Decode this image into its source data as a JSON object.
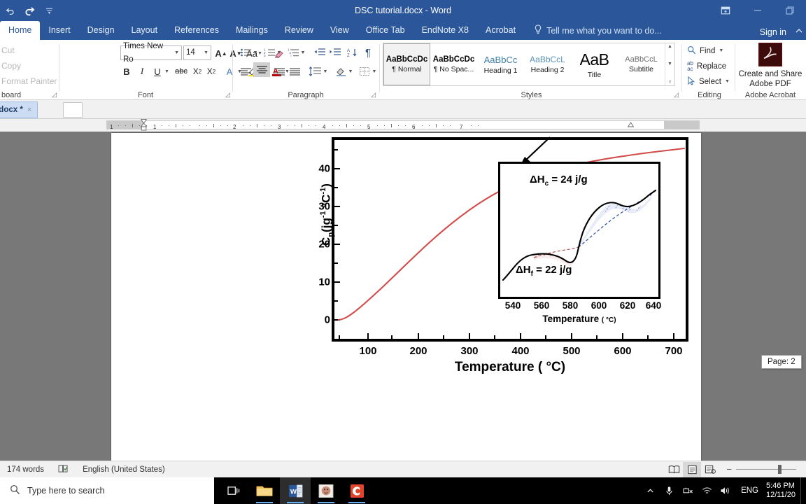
{
  "titlebar": {
    "document_title": "DSC tutorial.docx - Word",
    "quick_access": [
      {
        "name": "undo",
        "glyph": "↶"
      },
      {
        "name": "redo",
        "glyph": "↷"
      },
      {
        "name": "customize-quick-access-toolbar",
        "glyph": "≡"
      }
    ],
    "window_buttons": [
      {
        "name": "ribbon-display-options",
        "glyph": "▣"
      },
      {
        "name": "minimize",
        "glyph": "–"
      },
      {
        "name": "restore",
        "glyph": "❐"
      }
    ]
  },
  "ribbon_tabs": {
    "items": [
      {
        "label": "Home",
        "active": true
      },
      {
        "label": "Insert",
        "active": false
      },
      {
        "label": "Design",
        "active": false
      },
      {
        "label": "Layout",
        "active": false
      },
      {
        "label": "References",
        "active": false
      },
      {
        "label": "Mailings",
        "active": false
      },
      {
        "label": "Review",
        "active": false
      },
      {
        "label": "View",
        "active": false
      },
      {
        "label": "Office Tab",
        "active": false
      },
      {
        "label": "EndNote X8",
        "active": false
      },
      {
        "label": "Acrobat",
        "active": false
      }
    ],
    "tell_me": "Tell me what you want to do...",
    "sign_in": "Sign in"
  },
  "ribbon": {
    "clipboard": {
      "group_label": "board",
      "items": [
        "Cut",
        "Copy",
        "Format Painter"
      ]
    },
    "font": {
      "group_label": "Font",
      "font_name": "Times New Ro",
      "font_size": "14",
      "buttons": [
        {
          "name": "grow-font",
          "label": "A↑"
        },
        {
          "name": "shrink-font",
          "label": "A↓"
        },
        {
          "name": "change-case",
          "label": "Aa"
        },
        {
          "name": "clear-formatting",
          "label": "✒"
        },
        {
          "name": "bold",
          "label": "B"
        },
        {
          "name": "italic",
          "label": "I"
        },
        {
          "name": "underline",
          "label": "U"
        },
        {
          "name": "strikethrough",
          "label": "abc"
        },
        {
          "name": "subscript",
          "label": "X₂"
        },
        {
          "name": "superscript",
          "label": "X²"
        },
        {
          "name": "text-effects",
          "label": "A"
        },
        {
          "name": "text-highlight-color",
          "label": "ab"
        },
        {
          "name": "font-color",
          "label": "A"
        }
      ]
    },
    "paragraph": {
      "group_label": "Paragraph",
      "buttons": [
        {
          "name": "bullets",
          "label": "•≡"
        },
        {
          "name": "numbering",
          "label": "1≡"
        },
        {
          "name": "multilevel-list",
          "label": "≣"
        },
        {
          "name": "decrease-indent",
          "label": "⬅≡"
        },
        {
          "name": "increase-indent",
          "label": "➡≡"
        },
        {
          "name": "sort",
          "label": "A↓"
        },
        {
          "name": "show-formatting-marks",
          "label": "¶"
        },
        {
          "name": "align-left",
          "label": "≡"
        },
        {
          "name": "align-center",
          "label": "≡"
        },
        {
          "name": "align-right",
          "label": "≡"
        },
        {
          "name": "justify",
          "label": "≡"
        },
        {
          "name": "line-spacing",
          "label": "↕≡"
        },
        {
          "name": "shading",
          "label": "◢"
        },
        {
          "name": "borders",
          "label": "⊞"
        }
      ]
    },
    "styles": {
      "group_label": "Styles",
      "items": [
        {
          "preview": "AaBbCcDc",
          "name": "¶ Normal",
          "selected": true
        },
        {
          "preview": "AaBbCcDc",
          "name": "¶ No Spac...",
          "selected": false
        },
        {
          "preview": "AaBbCс",
          "name": "Heading 1",
          "selected": false
        },
        {
          "preview": "AaBbCcL",
          "name": "Heading 2",
          "selected": false
        },
        {
          "preview": "AaB",
          "name": "Title",
          "selected": false
        },
        {
          "preview": "AaBbCcL",
          "name": "Subtitle",
          "selected": false
        }
      ]
    },
    "editing": {
      "group_label": "Editing",
      "items": [
        {
          "label": "Find",
          "icon": "search-icon",
          "has_caret": true
        },
        {
          "label": "Replace",
          "icon": "replace-icon",
          "has_caret": false
        },
        {
          "label": "Select",
          "icon": "select-icon",
          "has_caret": true
        }
      ]
    },
    "acrobat": {
      "group_label": "Adobe Acrobat",
      "button_line1": "Create and Share",
      "button_line2": "Adobe PDF"
    }
  },
  "office_tab": {
    "document_tab": "torial.docx *",
    "close_glyph": "×"
  },
  "ruler": {
    "numbers": [
      "1",
      "1",
      "2",
      "3",
      "4",
      "5",
      "6",
      "7"
    ]
  },
  "chart_data": {
    "type": "line",
    "title": "",
    "xlabel": "Temperature ( °C)",
    "ylabel": "Cₚ(jg⁻¹ °C⁻¹)",
    "xlim": [
      30,
      760
    ],
    "ylim": [
      -6,
      48
    ],
    "xticks": [
      100,
      200,
      300,
      400,
      500,
      600,
      700
    ],
    "yticks": [
      0,
      10,
      20,
      30,
      40
    ],
    "grid": false,
    "legend": null,
    "series": [
      {
        "name": "Cp vs Temperature",
        "color": "#d34a4a",
        "x": [
          40,
          60,
          80,
          100,
          130,
          160,
          200,
          240,
          280,
          320,
          360,
          400,
          440,
          480,
          520,
          560,
          600,
          640,
          680,
          720,
          750
        ],
        "y": [
          0.0,
          0.3,
          1.0,
          2.2,
          4.4,
          6.9,
          10.5,
          14.2,
          18.0,
          21.8,
          25.4,
          28.9,
          32.1,
          34.9,
          37.3,
          39.4,
          41.2,
          42.7,
          44.0,
          45.2,
          46.0
        ]
      }
    ],
    "annotations": [
      {
        "type": "arrow",
        "note": "arrow pointing from main curve down to inset box"
      }
    ],
    "inset": {
      "type": "line",
      "xlabel": "Temperature ( °C)",
      "xticks": [
        540,
        560,
        580,
        600,
        620,
        640
      ],
      "xlim": [
        528,
        645
      ],
      "labels": [
        {
          "text": "ΔH",
          "sub": "c",
          "value": "= 24 j/g",
          "full": "ΔHc = 24 j/g"
        },
        {
          "text": "ΔH",
          "sub": "f",
          "value": "= 22 j/g",
          "full": "ΔHf = 22 j/g"
        }
      ],
      "series": [
        {
          "name": "DSC heat flow",
          "color": "#000000",
          "x": [
            528,
            535,
            542,
            550,
            557,
            563,
            570,
            576,
            581,
            584,
            587,
            590,
            594,
            598,
            601,
            605,
            609,
            613,
            618,
            625,
            632,
            640,
            644
          ],
          "y": [
            0.1,
            0.2,
            0.33,
            0.42,
            0.45,
            0.44,
            0.4,
            0.37,
            0.38,
            0.46,
            0.58,
            0.68,
            0.76,
            0.82,
            0.84,
            0.82,
            0.78,
            0.76,
            0.78,
            0.82,
            0.87,
            0.92,
            0.95
          ]
        }
      ],
      "shaded_regions": [
        {
          "name": "exothermic-crystallization",
          "color": "#2b4a9b",
          "hatch": "diagonal-dashed"
        },
        {
          "name": "endothermic-fusion",
          "color": "#b34a4a",
          "hatch": "diagonal-dashed"
        }
      ]
    }
  },
  "status_bar": {
    "word_count": "174 words",
    "proofing_icon": "spell-check-icon",
    "language": "English (United States)",
    "view_buttons": [
      {
        "name": "read-mode",
        "glyph": "📖",
        "active": false
      },
      {
        "name": "print-layout",
        "glyph": "▤",
        "active": true
      },
      {
        "name": "web-layout",
        "glyph": "▥",
        "active": false
      }
    ],
    "zoom_minus": "−",
    "zoom_plus": "+"
  },
  "page_tooltip": "Page: 2",
  "taskbar": {
    "search_placeholder": "Type here to search",
    "apps": [
      {
        "name": "task-view",
        "glyph": "⨉"
      },
      {
        "name": "file-explorer",
        "glyph": "📁"
      },
      {
        "name": "word",
        "glyph": "W"
      },
      {
        "name": "photos",
        "glyph": "◎"
      },
      {
        "name": "camtasia",
        "glyph": "C"
      }
    ],
    "tray": {
      "show_hidden": "∧",
      "icons": [
        "microphone-icon",
        "network-disconnected-icon",
        "wifi-icon",
        "volume-icon"
      ],
      "language": "ENG",
      "time": "5:46 PM",
      "date": "12/11/20"
    }
  }
}
